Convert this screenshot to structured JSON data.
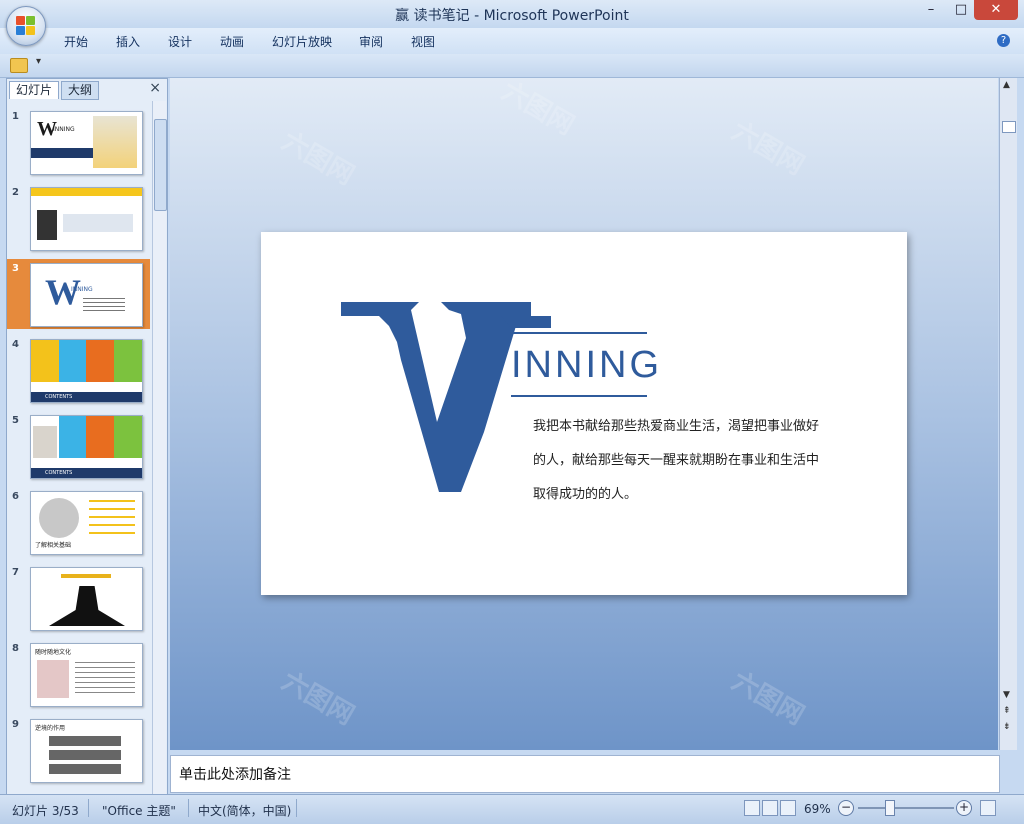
{
  "window": {
    "title": "赢 读书笔记 - Microsoft PowerPoint",
    "minimize": "–",
    "maximize": "□",
    "close": "✕"
  },
  "ribbon": {
    "tabs": [
      "开始",
      "插入",
      "设计",
      "动画",
      "幻灯片放映",
      "审阅",
      "视图"
    ],
    "help": "?"
  },
  "left_panel": {
    "tab_slides": "幻灯片",
    "tab_outline": "大纲",
    "close": "×",
    "selected_index": 3,
    "thumbnails": [
      {
        "number": "1",
        "caption": "INNING"
      },
      {
        "number": "2",
        "caption": ""
      },
      {
        "number": "3",
        "caption": "INNING"
      },
      {
        "number": "4",
        "caption": "CONTENTS"
      },
      {
        "number": "5",
        "caption": "CONTENTS"
      },
      {
        "number": "6",
        "caption": "了解相关基础"
      },
      {
        "number": "7",
        "caption": ""
      },
      {
        "number": "8",
        "caption": "随时随地文化"
      },
      {
        "number": "9",
        "caption": "逆境的作用"
      }
    ]
  },
  "slide": {
    "big_letter": "W",
    "heading": "INNING",
    "text": "我把本书献给那些热爱商业生活，渴望把事业做好的人，献给那些每天一醒来就期盼在事业和生活中取得成功的的人。",
    "lines": [
      "我把本书献给那些热爱商业生活，渴望把事业做好",
      "的人，献给那些每天一醒来就期盼在事业和生活中",
      "取得成功的的人。"
    ]
  },
  "notes": {
    "placeholder": "单击此处添加备注"
  },
  "status": {
    "slide_position": "幻灯片 3/53",
    "theme": "\"Office 主题\"",
    "language": "中文(简体，中国)",
    "zoom": "69%",
    "zoom_value": 0.69
  },
  "watermark": "六图网",
  "colors": {
    "accent": "#2f5b9c",
    "selected_thumb": "#e68a3c",
    "canvas_bottom": "#6e94c8"
  }
}
